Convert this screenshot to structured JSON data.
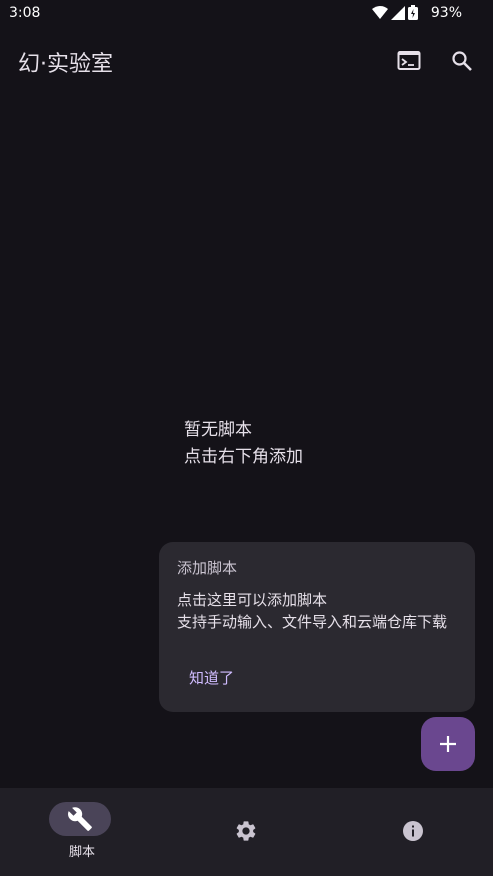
{
  "status_bar": {
    "time": "3:08",
    "battery": "93%"
  },
  "app_bar": {
    "title": "幻·实验室"
  },
  "empty_state": {
    "line1": "暂无脚本",
    "line2": "点击右下角添加"
  },
  "tooltip": {
    "title": "添加脚本",
    "body_line1": "点击这里可以添加脚本",
    "body_line2": "支持手动输入、文件导入和云端仓库下载",
    "action_label": "知道了"
  },
  "fab": {
    "icon": "plus-icon"
  },
  "bottom_nav": {
    "items": [
      {
        "label": "脚本",
        "icon": "wrench-icon",
        "selected": true
      },
      {
        "label": "",
        "icon": "gear-icon",
        "selected": false
      },
      {
        "label": "",
        "icon": "info-icon",
        "selected": false
      }
    ]
  },
  "colors": {
    "background": "#141218",
    "card": "#2b2930",
    "accent": "#d0bcff",
    "fab": "#6a478f",
    "nav_bar": "#211f26"
  }
}
